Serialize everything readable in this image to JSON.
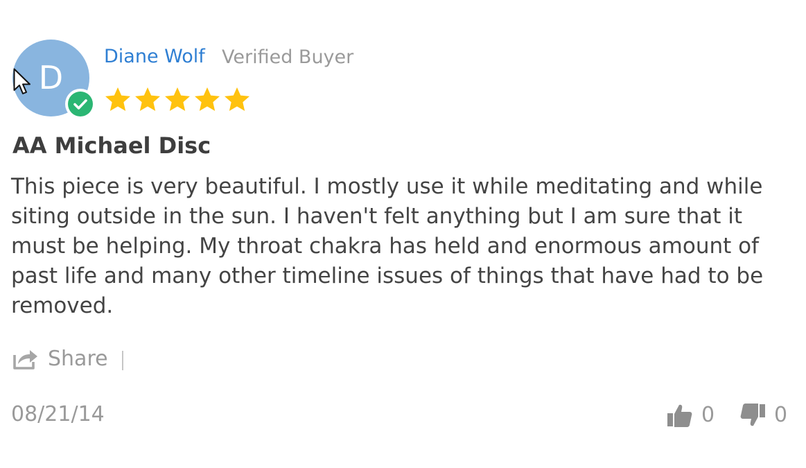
{
  "reviewer": {
    "initial": "D",
    "name": "Diane Wolf",
    "status": "Verified Buyer",
    "rating": 5,
    "avatar_color": "#89b5df",
    "badge_color": "#2bb673",
    "badge_icon": "check-icon"
  },
  "review": {
    "title": "AA Michael Disc",
    "body": "This piece is very beautiful. I mostly use it while meditating and while siting outside in the sun. I haven't felt anything but I am sure that it must be helping. My throat chakra has held and enormous amount of past life and many other timeline issues of things that have had to be removed.",
    "date": "08/21/14"
  },
  "actions": {
    "share_label": "Share",
    "share_icon": "share-icon",
    "upvote_icon": "thumbs-up-icon",
    "downvote_icon": "thumbs-down-icon",
    "upvotes": "0",
    "downvotes": "0"
  },
  "colors": {
    "name_link": "#2f7fd3",
    "star": "#ffc20e",
    "muted_text": "#9a9a9a",
    "body_text": "#444444"
  }
}
